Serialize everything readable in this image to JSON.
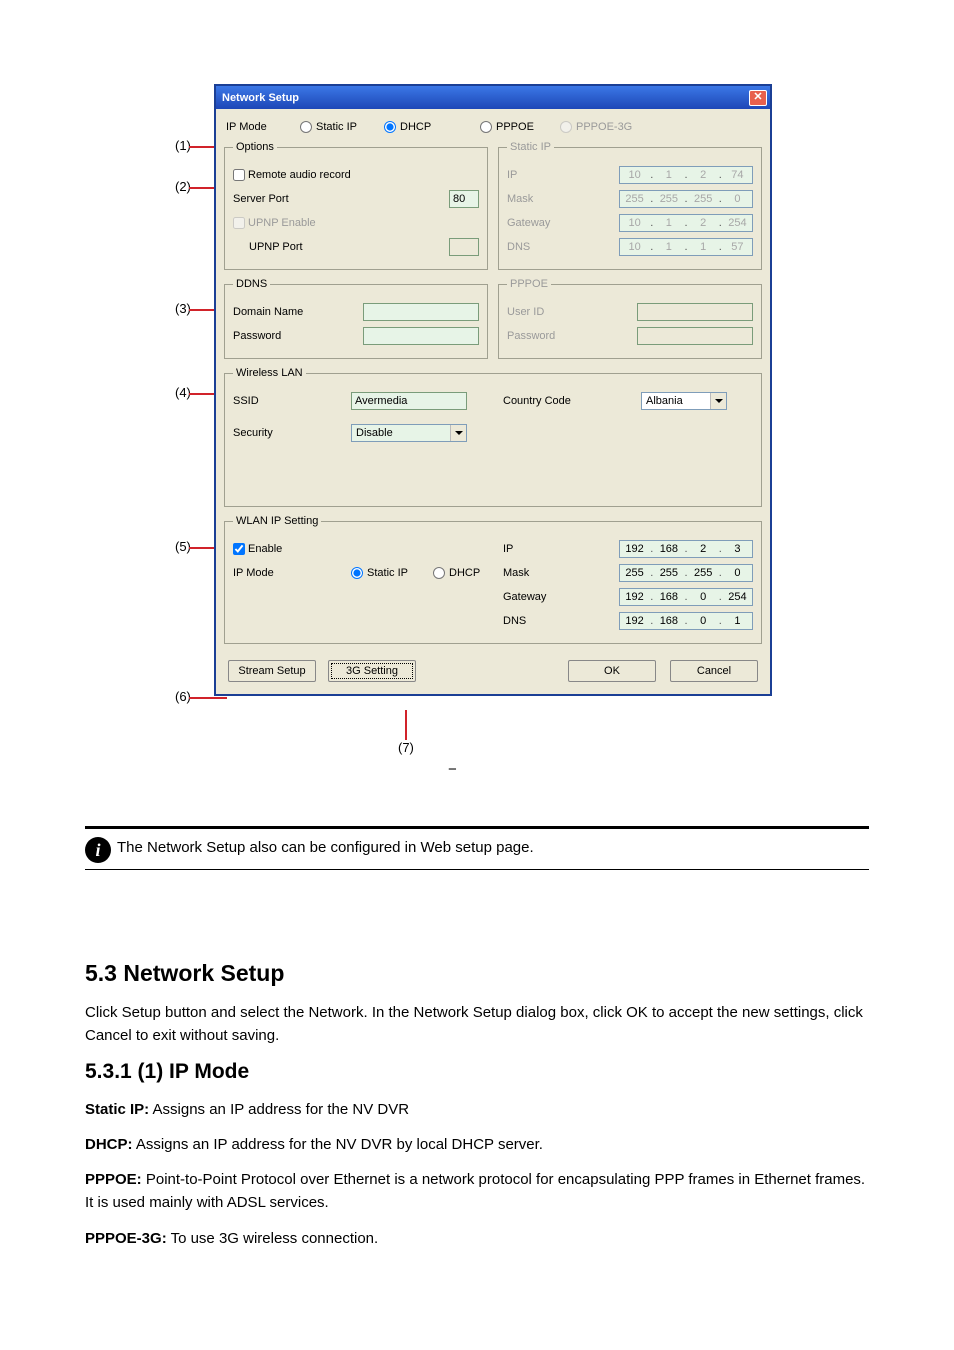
{
  "dialog": {
    "title": "Network Setup",
    "ipmode": {
      "label": "IP Mode",
      "static": "Static IP",
      "dhcp": "DHCP",
      "pppoe": "PPPOE",
      "pppoe3g": "PPPOE-3G"
    },
    "options": {
      "legend": "Options",
      "remote_audio": "Remote audio record",
      "server_port": "Server Port",
      "server_port_val": "80",
      "upnp_enable": "UPNP Enable",
      "upnp_port": "UPNP Port",
      "upnp_port_val": ""
    },
    "staticip": {
      "legend": "Static IP",
      "ip_label": "IP",
      "ip": [
        "10",
        "1",
        "2",
        "74"
      ],
      "mask_label": "Mask",
      "mask": [
        "255",
        "255",
        "255",
        "0"
      ],
      "gateway_label": "Gateway",
      "gateway": [
        "10",
        "1",
        "2",
        "254"
      ],
      "dns_label": "DNS",
      "dns": [
        "10",
        "1",
        "1",
        "57"
      ]
    },
    "ddns": {
      "legend": "DDNS",
      "domain_label": "Domain Name",
      "domain_val": "",
      "password_label": "Password",
      "password_val": ""
    },
    "pppoe": {
      "legend": "PPPOE",
      "userid_label": "User ID",
      "userid_val": "",
      "password_label": "Password",
      "password_val": ""
    },
    "wlan": {
      "legend": "Wireless LAN",
      "ssid_label": "SSID",
      "ssid_val": "Avermedia",
      "country_label": "Country Code",
      "country_val": "Albania",
      "security_label": "Security",
      "security_val": "Disable"
    },
    "wlanip": {
      "legend": "WLAN IP Setting",
      "enable": "Enable",
      "ipmode_label": "IP Mode",
      "static": "Static IP",
      "dhcp": "DHCP",
      "ip_label": "IP",
      "ip": [
        "192",
        "168",
        "2",
        "3"
      ],
      "mask_label": "Mask",
      "mask": [
        "255",
        "255",
        "255",
        "0"
      ],
      "gateway_label": "Gateway",
      "gateway": [
        "192",
        "168",
        "0",
        "254"
      ],
      "dns_label": "DNS",
      "dns": [
        "192",
        "168",
        "0",
        "1"
      ]
    },
    "buttons": {
      "stream": "Stream Setup",
      "g3": "3G Setting",
      "ok": "OK",
      "cancel": "Cancel"
    }
  },
  "callouts": {
    "c1": "(1)",
    "c2": "(2)",
    "c3": "(3)",
    "c4": "(4)",
    "c5": "(5)",
    "c6": "(6)",
    "c7": "(7)"
  },
  "dash": "−",
  "note": "The Network Setup also can be configured in Web setup page.",
  "section53": {
    "heading": "5.3 Network Setup",
    "para": "Click Setup button and select the Network. In the Network Setup dialog box, click OK to accept the new settings, click Cancel to exit without saving.",
    "sub531": "5.3.1 (1) IP Mode",
    "static": "Static IP:",
    "static_text": " Assigns an IP address for the NV DVR",
    "dhcp": "DHCP:",
    "dhcp_text": " Assigns an IP address for the NV DVR by local DHCP server.",
    "pppoe": "PPPOE:",
    "pppoe_text": " Point-to-Point Protocol over Ethernet is a network protocol for encapsulating PPP frames in Ethernet frames. It is used mainly with ADSL services.",
    "pppoe3g": "PPPOE-3G:",
    "pppoe3g_text": " To use 3G wireless connection."
  }
}
